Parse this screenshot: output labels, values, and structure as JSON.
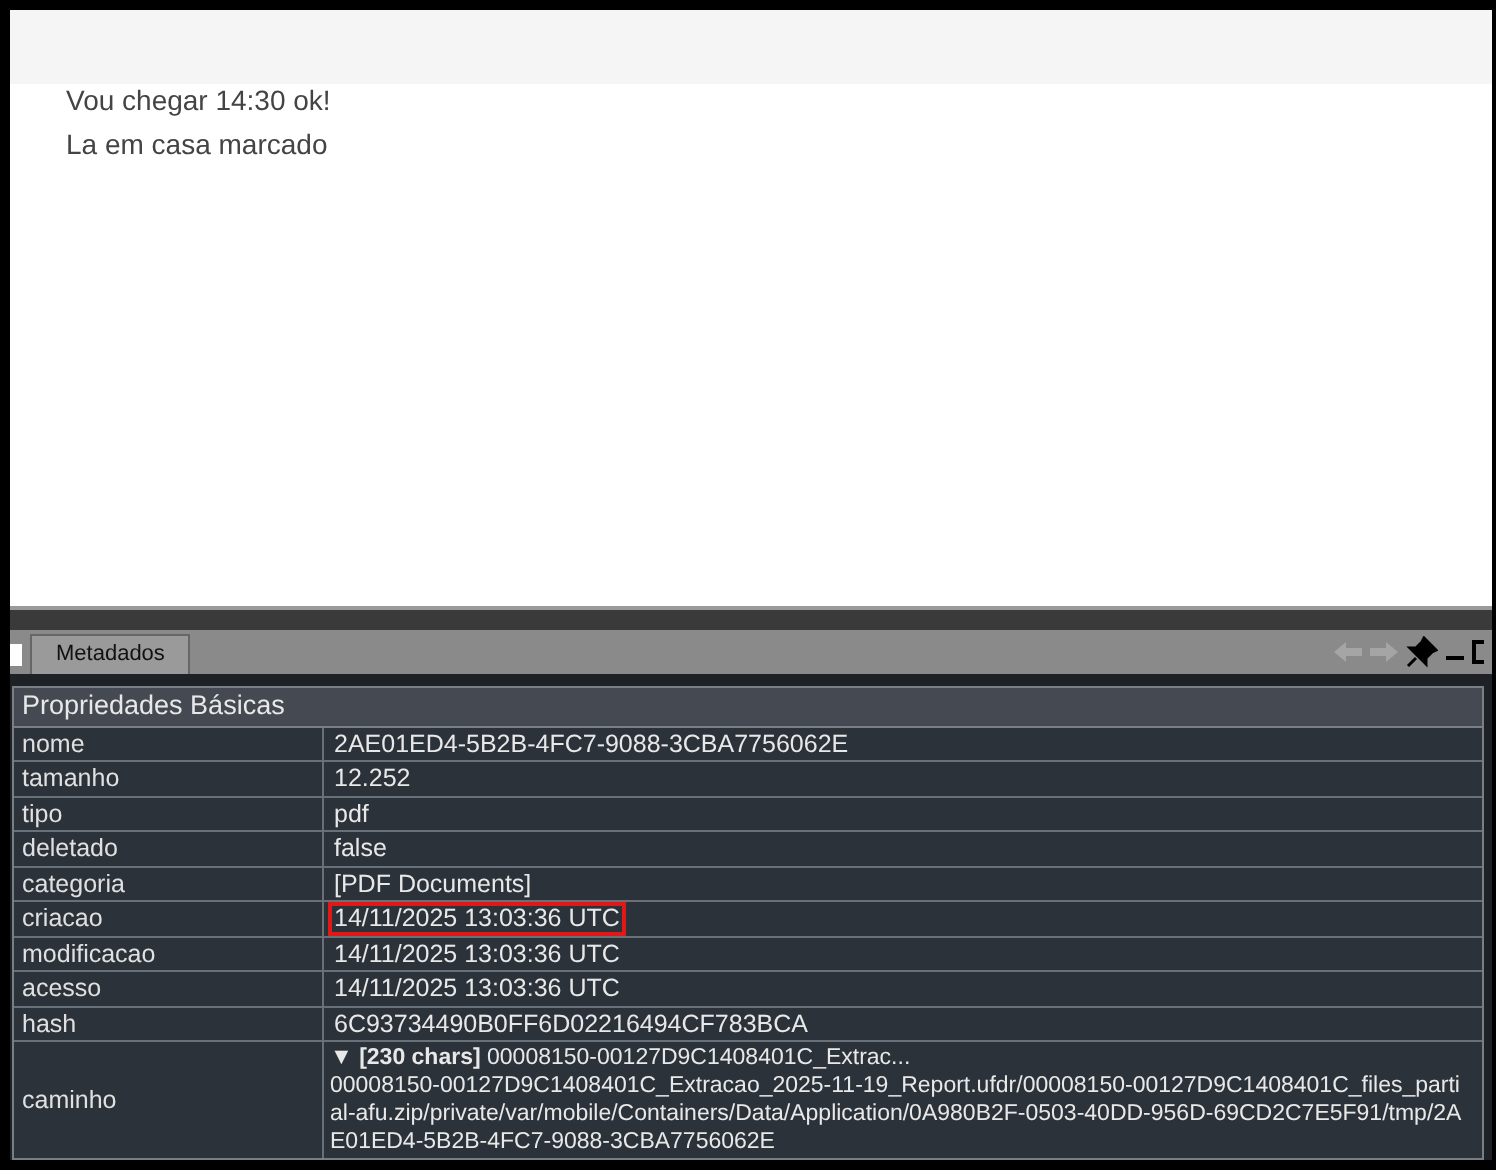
{
  "message_lines": [
    "Vou chegar 14:30 ok!",
    "La em casa marcado"
  ],
  "panel": {
    "tab": {
      "label": "Metadados",
      "selected": true
    }
  },
  "table": {
    "section": "Propriedades Básicas",
    "rows": [
      {
        "key": "nome",
        "value": "2AE01ED4-5B2B-4FC7-9088-3CBA7756062E",
        "highlighted": false
      },
      {
        "key": "tamanho",
        "value": "12.252",
        "highlighted": false
      },
      {
        "key": "tipo",
        "value": "pdf",
        "highlighted": false
      },
      {
        "key": "deletado",
        "value": "false",
        "highlighted": false
      },
      {
        "key": "categoria",
        "value": "[PDF Documents]",
        "highlighted": false
      },
      {
        "key": "criacao",
        "value": "14/11/2025 13:03:36 UTC",
        "highlighted": true
      },
      {
        "key": "modificacao",
        "value": "14/11/2025 13:03:36 UTC",
        "highlighted": false
      },
      {
        "key": "acesso",
        "value": "14/11/2025 13:03:36 UTC",
        "highlighted": false
      },
      {
        "key": "hash",
        "value": "6C93734490B0FF6D02216494CF783BCA",
        "highlighted": false
      }
    ],
    "path_row": {
      "key": "caminho",
      "summary": "▼ **[230 chars]** 00008150-00127D9C1408401C_Extrac...",
      "lines": [
        "00008150-00127D9C1408401C_Extracao_2025-11-19_Report.ufdr/00008150-00127D9C1408401C_files_parti",
        "al-afu.zip/private/var/mobile/Containers/Data/Application/0A980B2F-0503-40DD-956D-69CD2C7E5F91/tmp/2A",
        "E01ED4-5B2B-4FC7-9088-3CBA7756062E"
      ]
    }
  }
}
